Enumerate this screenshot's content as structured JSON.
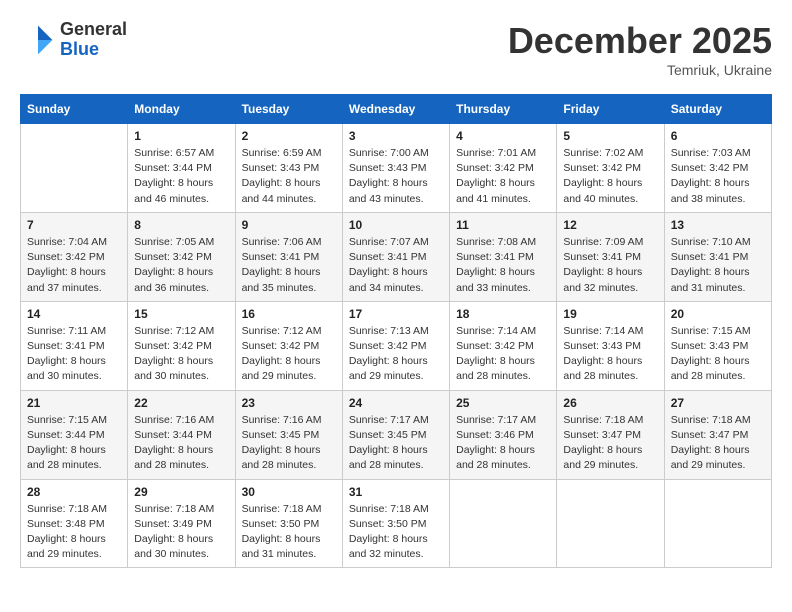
{
  "header": {
    "logo_general": "General",
    "logo_blue": "Blue",
    "month_title": "December 2025",
    "subtitle": "Temriuk, Ukraine"
  },
  "weekdays": [
    "Sunday",
    "Monday",
    "Tuesday",
    "Wednesday",
    "Thursday",
    "Friday",
    "Saturday"
  ],
  "weeks": [
    [
      {
        "day": "",
        "sunrise": "",
        "sunset": "",
        "daylight": ""
      },
      {
        "day": "1",
        "sunrise": "Sunrise: 6:57 AM",
        "sunset": "Sunset: 3:44 PM",
        "daylight": "Daylight: 8 hours and 46 minutes."
      },
      {
        "day": "2",
        "sunrise": "Sunrise: 6:59 AM",
        "sunset": "Sunset: 3:43 PM",
        "daylight": "Daylight: 8 hours and 44 minutes."
      },
      {
        "day": "3",
        "sunrise": "Sunrise: 7:00 AM",
        "sunset": "Sunset: 3:43 PM",
        "daylight": "Daylight: 8 hours and 43 minutes."
      },
      {
        "day": "4",
        "sunrise": "Sunrise: 7:01 AM",
        "sunset": "Sunset: 3:42 PM",
        "daylight": "Daylight: 8 hours and 41 minutes."
      },
      {
        "day": "5",
        "sunrise": "Sunrise: 7:02 AM",
        "sunset": "Sunset: 3:42 PM",
        "daylight": "Daylight: 8 hours and 40 minutes."
      },
      {
        "day": "6",
        "sunrise": "Sunrise: 7:03 AM",
        "sunset": "Sunset: 3:42 PM",
        "daylight": "Daylight: 8 hours and 38 minutes."
      }
    ],
    [
      {
        "day": "7",
        "sunrise": "Sunrise: 7:04 AM",
        "sunset": "Sunset: 3:42 PM",
        "daylight": "Daylight: 8 hours and 37 minutes."
      },
      {
        "day": "8",
        "sunrise": "Sunrise: 7:05 AM",
        "sunset": "Sunset: 3:42 PM",
        "daylight": "Daylight: 8 hours and 36 minutes."
      },
      {
        "day": "9",
        "sunrise": "Sunrise: 7:06 AM",
        "sunset": "Sunset: 3:41 PM",
        "daylight": "Daylight: 8 hours and 35 minutes."
      },
      {
        "day": "10",
        "sunrise": "Sunrise: 7:07 AM",
        "sunset": "Sunset: 3:41 PM",
        "daylight": "Daylight: 8 hours and 34 minutes."
      },
      {
        "day": "11",
        "sunrise": "Sunrise: 7:08 AM",
        "sunset": "Sunset: 3:41 PM",
        "daylight": "Daylight: 8 hours and 33 minutes."
      },
      {
        "day": "12",
        "sunrise": "Sunrise: 7:09 AM",
        "sunset": "Sunset: 3:41 PM",
        "daylight": "Daylight: 8 hours and 32 minutes."
      },
      {
        "day": "13",
        "sunrise": "Sunrise: 7:10 AM",
        "sunset": "Sunset: 3:41 PM",
        "daylight": "Daylight: 8 hours and 31 minutes."
      }
    ],
    [
      {
        "day": "14",
        "sunrise": "Sunrise: 7:11 AM",
        "sunset": "Sunset: 3:41 PM",
        "daylight": "Daylight: 8 hours and 30 minutes."
      },
      {
        "day": "15",
        "sunrise": "Sunrise: 7:12 AM",
        "sunset": "Sunset: 3:42 PM",
        "daylight": "Daylight: 8 hours and 30 minutes."
      },
      {
        "day": "16",
        "sunrise": "Sunrise: 7:12 AM",
        "sunset": "Sunset: 3:42 PM",
        "daylight": "Daylight: 8 hours and 29 minutes."
      },
      {
        "day": "17",
        "sunrise": "Sunrise: 7:13 AM",
        "sunset": "Sunset: 3:42 PM",
        "daylight": "Daylight: 8 hours and 29 minutes."
      },
      {
        "day": "18",
        "sunrise": "Sunrise: 7:14 AM",
        "sunset": "Sunset: 3:42 PM",
        "daylight": "Daylight: 8 hours and 28 minutes."
      },
      {
        "day": "19",
        "sunrise": "Sunrise: 7:14 AM",
        "sunset": "Sunset: 3:43 PM",
        "daylight": "Daylight: 8 hours and 28 minutes."
      },
      {
        "day": "20",
        "sunrise": "Sunrise: 7:15 AM",
        "sunset": "Sunset: 3:43 PM",
        "daylight": "Daylight: 8 hours and 28 minutes."
      }
    ],
    [
      {
        "day": "21",
        "sunrise": "Sunrise: 7:15 AM",
        "sunset": "Sunset: 3:44 PM",
        "daylight": "Daylight: 8 hours and 28 minutes."
      },
      {
        "day": "22",
        "sunrise": "Sunrise: 7:16 AM",
        "sunset": "Sunset: 3:44 PM",
        "daylight": "Daylight: 8 hours and 28 minutes."
      },
      {
        "day": "23",
        "sunrise": "Sunrise: 7:16 AM",
        "sunset": "Sunset: 3:45 PM",
        "daylight": "Daylight: 8 hours and 28 minutes."
      },
      {
        "day": "24",
        "sunrise": "Sunrise: 7:17 AM",
        "sunset": "Sunset: 3:45 PM",
        "daylight": "Daylight: 8 hours and 28 minutes."
      },
      {
        "day": "25",
        "sunrise": "Sunrise: 7:17 AM",
        "sunset": "Sunset: 3:46 PM",
        "daylight": "Daylight: 8 hours and 28 minutes."
      },
      {
        "day": "26",
        "sunrise": "Sunrise: 7:18 AM",
        "sunset": "Sunset: 3:47 PM",
        "daylight": "Daylight: 8 hours and 29 minutes."
      },
      {
        "day": "27",
        "sunrise": "Sunrise: 7:18 AM",
        "sunset": "Sunset: 3:47 PM",
        "daylight": "Daylight: 8 hours and 29 minutes."
      }
    ],
    [
      {
        "day": "28",
        "sunrise": "Sunrise: 7:18 AM",
        "sunset": "Sunset: 3:48 PM",
        "daylight": "Daylight: 8 hours and 29 minutes."
      },
      {
        "day": "29",
        "sunrise": "Sunrise: 7:18 AM",
        "sunset": "Sunset: 3:49 PM",
        "daylight": "Daylight: 8 hours and 30 minutes."
      },
      {
        "day": "30",
        "sunrise": "Sunrise: 7:18 AM",
        "sunset": "Sunset: 3:50 PM",
        "daylight": "Daylight: 8 hours and 31 minutes."
      },
      {
        "day": "31",
        "sunrise": "Sunrise: 7:18 AM",
        "sunset": "Sunset: 3:50 PM",
        "daylight": "Daylight: 8 hours and 32 minutes."
      },
      {
        "day": "",
        "sunrise": "",
        "sunset": "",
        "daylight": ""
      },
      {
        "day": "",
        "sunrise": "",
        "sunset": "",
        "daylight": ""
      },
      {
        "day": "",
        "sunrise": "",
        "sunset": "",
        "daylight": ""
      }
    ]
  ]
}
